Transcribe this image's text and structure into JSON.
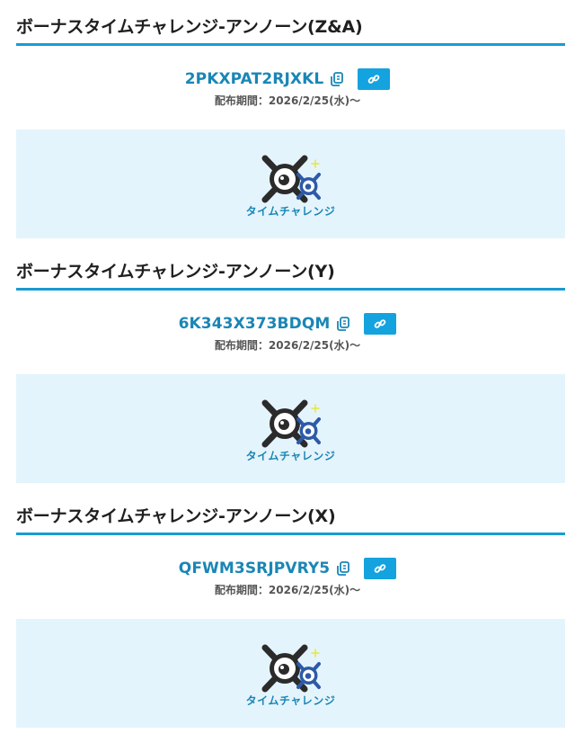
{
  "sections": [
    {
      "title": "ボーナスタイムチャレンジ-アンノーン(Z&A)",
      "code": "2PKXPAT2RJXKL",
      "period": "配布期間：2026/2/25(水)〜",
      "banner_label": "タイムチャレンジ"
    },
    {
      "title": "ボーナスタイムチャレンジ-アンノーン(Y)",
      "code": "6K343X373BDQM",
      "period": "配布期間：2026/2/25(水)〜",
      "banner_label": "タイムチャレンジ"
    },
    {
      "title": "ボーナスタイムチャレンジ-アンノーン(X)",
      "code": "QFWM3SRJPVRY5",
      "period": "配布期間：2026/2/25(水)〜",
      "banner_label": "タイムチャレンジ"
    }
  ],
  "icons": {
    "copy": "copy-icon",
    "link": "link-icon",
    "banner": "time-challenge-icon"
  },
  "colors": {
    "accent": "#1a9bd2",
    "code_text": "#1a86b5",
    "link_button": "#14a3de",
    "banner_bg": "#e4f4fc",
    "title_text": "#1f1f1f"
  }
}
